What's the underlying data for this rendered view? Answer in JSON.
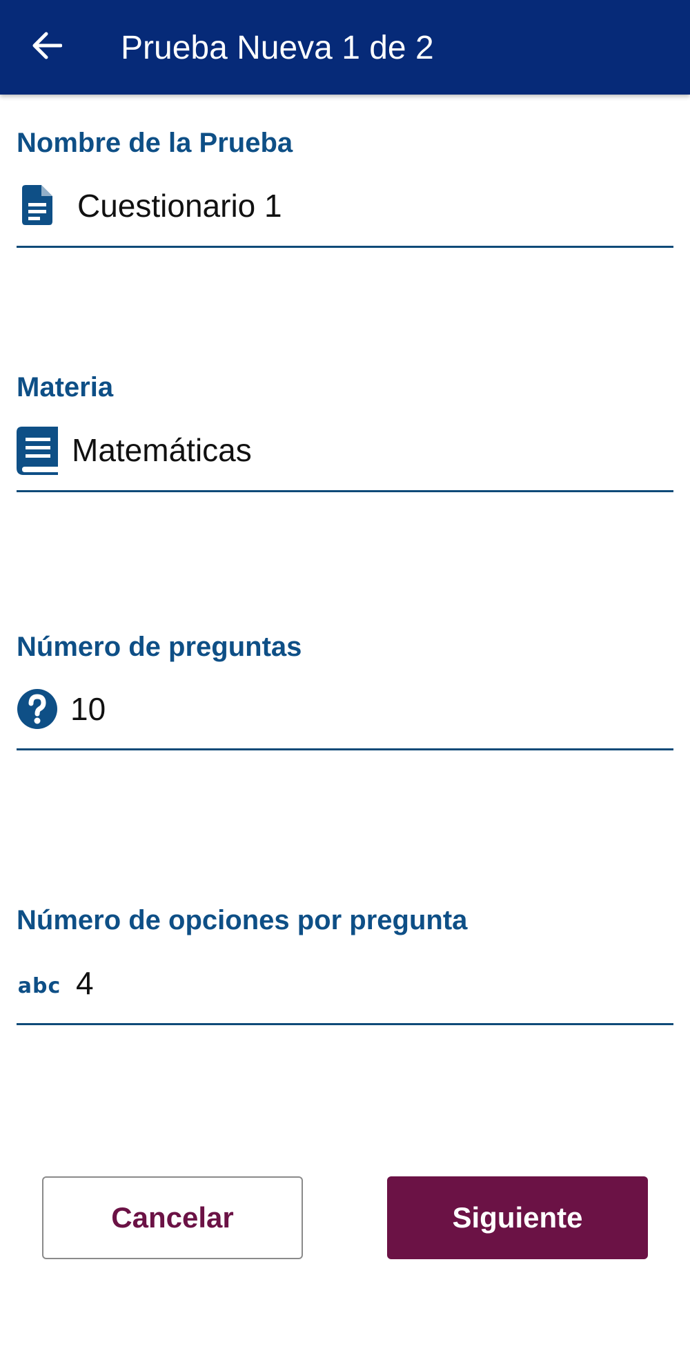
{
  "header": {
    "title": "Prueba Nueva 1 de 2",
    "back_icon": "arrow-left-icon"
  },
  "form": {
    "test_name": {
      "label": "Nombre de la Prueba",
      "value": "Cuestionario 1",
      "icon": "document-icon"
    },
    "subject": {
      "label": "Materia",
      "value": "Matemáticas",
      "icon": "book-icon"
    },
    "question_count": {
      "label": "Número de preguntas",
      "value": "10",
      "icon": "question-circle-icon"
    },
    "options_per_question": {
      "label": "Número de opciones por pregunta",
      "value": "4",
      "icon": "abc-icon",
      "icon_text": "abc"
    }
  },
  "actions": {
    "cancel_label": "Cancelar",
    "next_label": "Siguiente"
  },
  "colors": {
    "appbar": "#062a78",
    "label": "#0e4f86",
    "accent": "#6b1245",
    "underline": "#0e4a78"
  }
}
